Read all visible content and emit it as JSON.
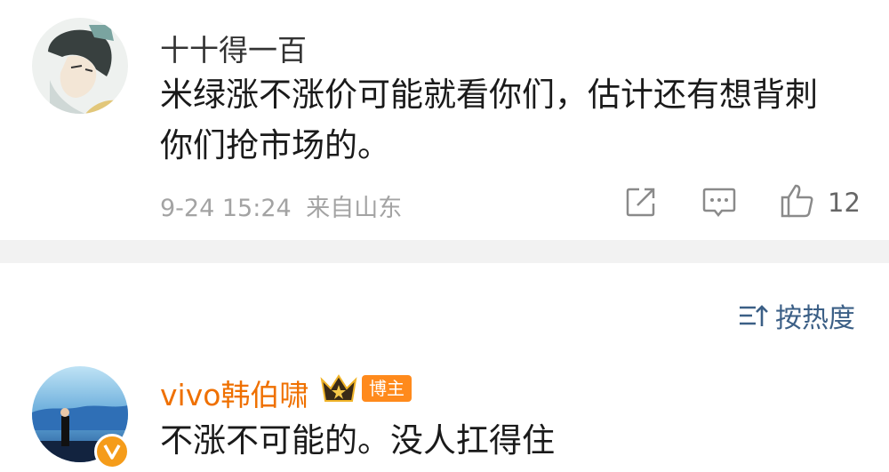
{
  "comments": [
    {
      "username": "十十得一百",
      "text_line1": "米绿涨不涨价可能就看你们，估计还有想背刺",
      "text_line2": "你们抢市场的。",
      "time": "9-24 15:24",
      "location": "来自山东",
      "likes": "12"
    },
    {
      "username": "vivo韩伯啸",
      "badge": "博主",
      "text": "不涨不可能的。没人扛得住"
    }
  ],
  "sort": {
    "label": "按热度"
  },
  "colors": {
    "vip_name": "#ef7000",
    "sort_accent": "#3b5f86",
    "separator": "#f2f2f2",
    "meta": "#a3a3a3",
    "badge": "#ff8a1c"
  },
  "icons": {
    "share": "share-icon",
    "comment": "comment-icon",
    "like": "thumbs-up-icon",
    "sort": "sort-icon",
    "crown": "crown-icon",
    "verified": "verified-badge-icon"
  }
}
